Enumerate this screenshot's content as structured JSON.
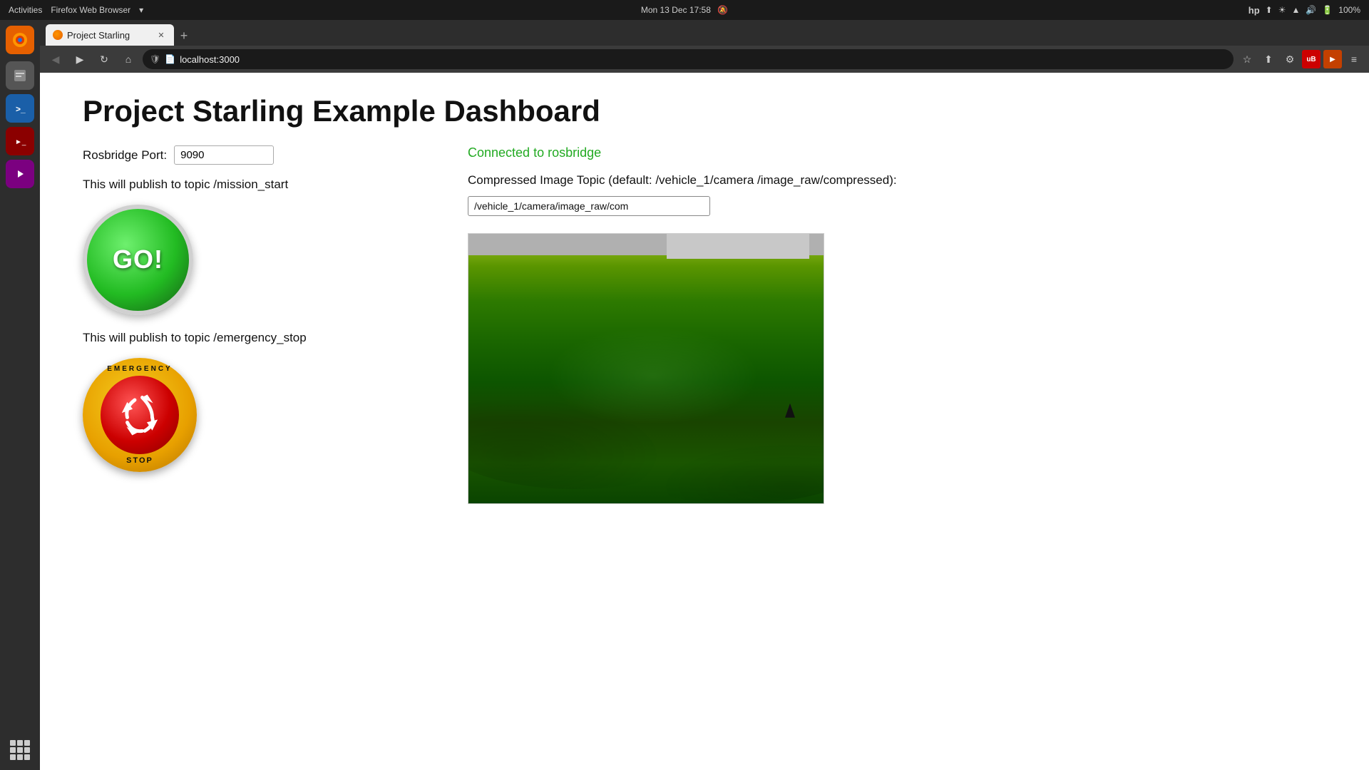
{
  "os": {
    "topbar": {
      "left": "Activities",
      "browser_label": "Firefox Web Browser",
      "datetime": "Mon 13 Dec  17:58",
      "battery": "100%"
    }
  },
  "browser": {
    "tab_title": "Project Starling",
    "url": "localhost:3000",
    "new_tab_label": "+"
  },
  "page": {
    "title": "Project Starling Example Dashboard",
    "rosbridge_label": "Rosbridge Port:",
    "rosbridge_port": "9090",
    "publish_mission_text": "This will publish to topic /mission_start",
    "go_button_label": "GO!",
    "publish_emergency_text": "This will publish to topic /emergency_stop",
    "emergency_top": "EMERGENCY",
    "emergency_bottom": "STOP",
    "connected_text": "Connected to rosbridge",
    "topic_label": "Compressed Image Topic (default: /vehicle_1/camera /image_raw/compressed):",
    "topic_value": "/vehicle_1/camera/image_raw/com"
  }
}
